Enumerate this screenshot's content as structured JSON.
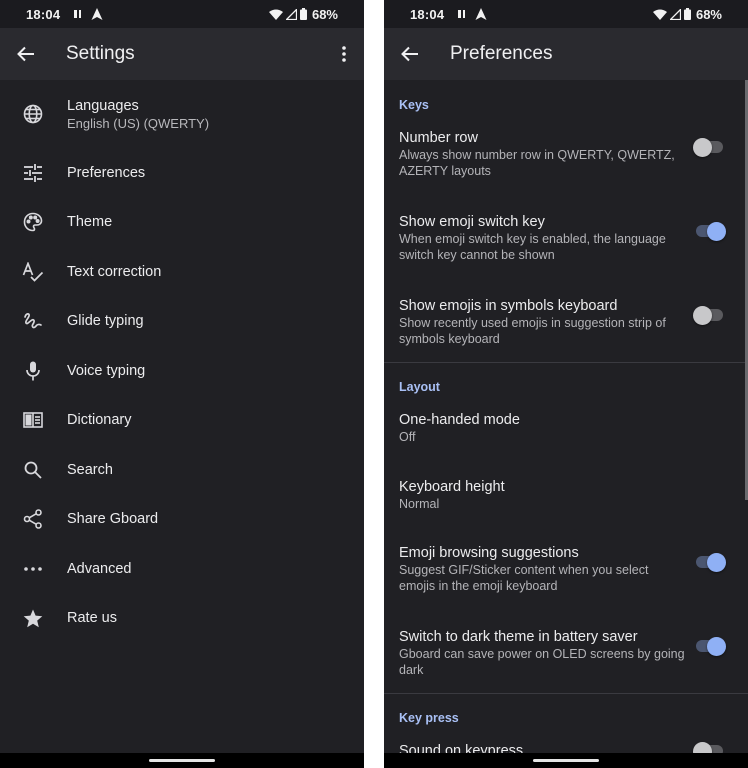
{
  "status_bar": {
    "time": "18:04",
    "battery": "68%"
  },
  "left_screen": {
    "title": "Settings",
    "items": [
      {
        "label": "Languages",
        "sub": "English (US) (QWERTY)",
        "icon": "globe-icon"
      },
      {
        "label": "Preferences",
        "icon": "tune-sliders-icon"
      },
      {
        "label": "Theme",
        "icon": "palette-icon"
      },
      {
        "label": "Text correction",
        "icon": "spellcheck-icon"
      },
      {
        "label": "Glide typing",
        "icon": "gesture-icon"
      },
      {
        "label": "Voice typing",
        "icon": "microphone-icon"
      },
      {
        "label": "Dictionary",
        "icon": "book-icon"
      },
      {
        "label": "Search",
        "icon": "search-icon"
      },
      {
        "label": "Share Gboard",
        "icon": "share-icon"
      },
      {
        "label": "Advanced",
        "icon": "more-horizontal-icon"
      },
      {
        "label": "Rate us",
        "icon": "star-icon"
      }
    ]
  },
  "right_screen": {
    "title": "Preferences",
    "sections": [
      {
        "title": "Keys",
        "items": [
          {
            "label": "Number row",
            "sub": "Always show number row in QWERTY, QWERTZ, AZERTY layouts",
            "toggle": false
          },
          {
            "label": "Show emoji switch key",
            "sub": "When emoji switch key is enabled, the language switch key cannot be shown",
            "toggle": true
          },
          {
            "label": "Show emojis in symbols keyboard",
            "sub": "Show recently used emojis in suggestion strip of symbols keyboard",
            "toggle": false
          }
        ]
      },
      {
        "title": "Layout",
        "items": [
          {
            "label": "One-handed mode",
            "sub": "Off"
          },
          {
            "label": "Keyboard height",
            "sub": "Normal"
          },
          {
            "label": "Emoji browsing suggestions",
            "sub": "Suggest GIF/Sticker content when you select emojis in the emoji keyboard",
            "toggle": true
          },
          {
            "label": "Switch to dark theme in battery saver",
            "sub": "Gboard can save power on OLED screens by going dark",
            "toggle": true
          }
        ]
      },
      {
        "title": "Key press",
        "items": [
          {
            "label": "Sound on keypress",
            "toggle": false
          }
        ]
      }
    ]
  },
  "colors": {
    "background": "#202024",
    "app_bar": "#2a2a2f",
    "accent": "#8fb0f5",
    "section_title": "#a9c0f5"
  }
}
